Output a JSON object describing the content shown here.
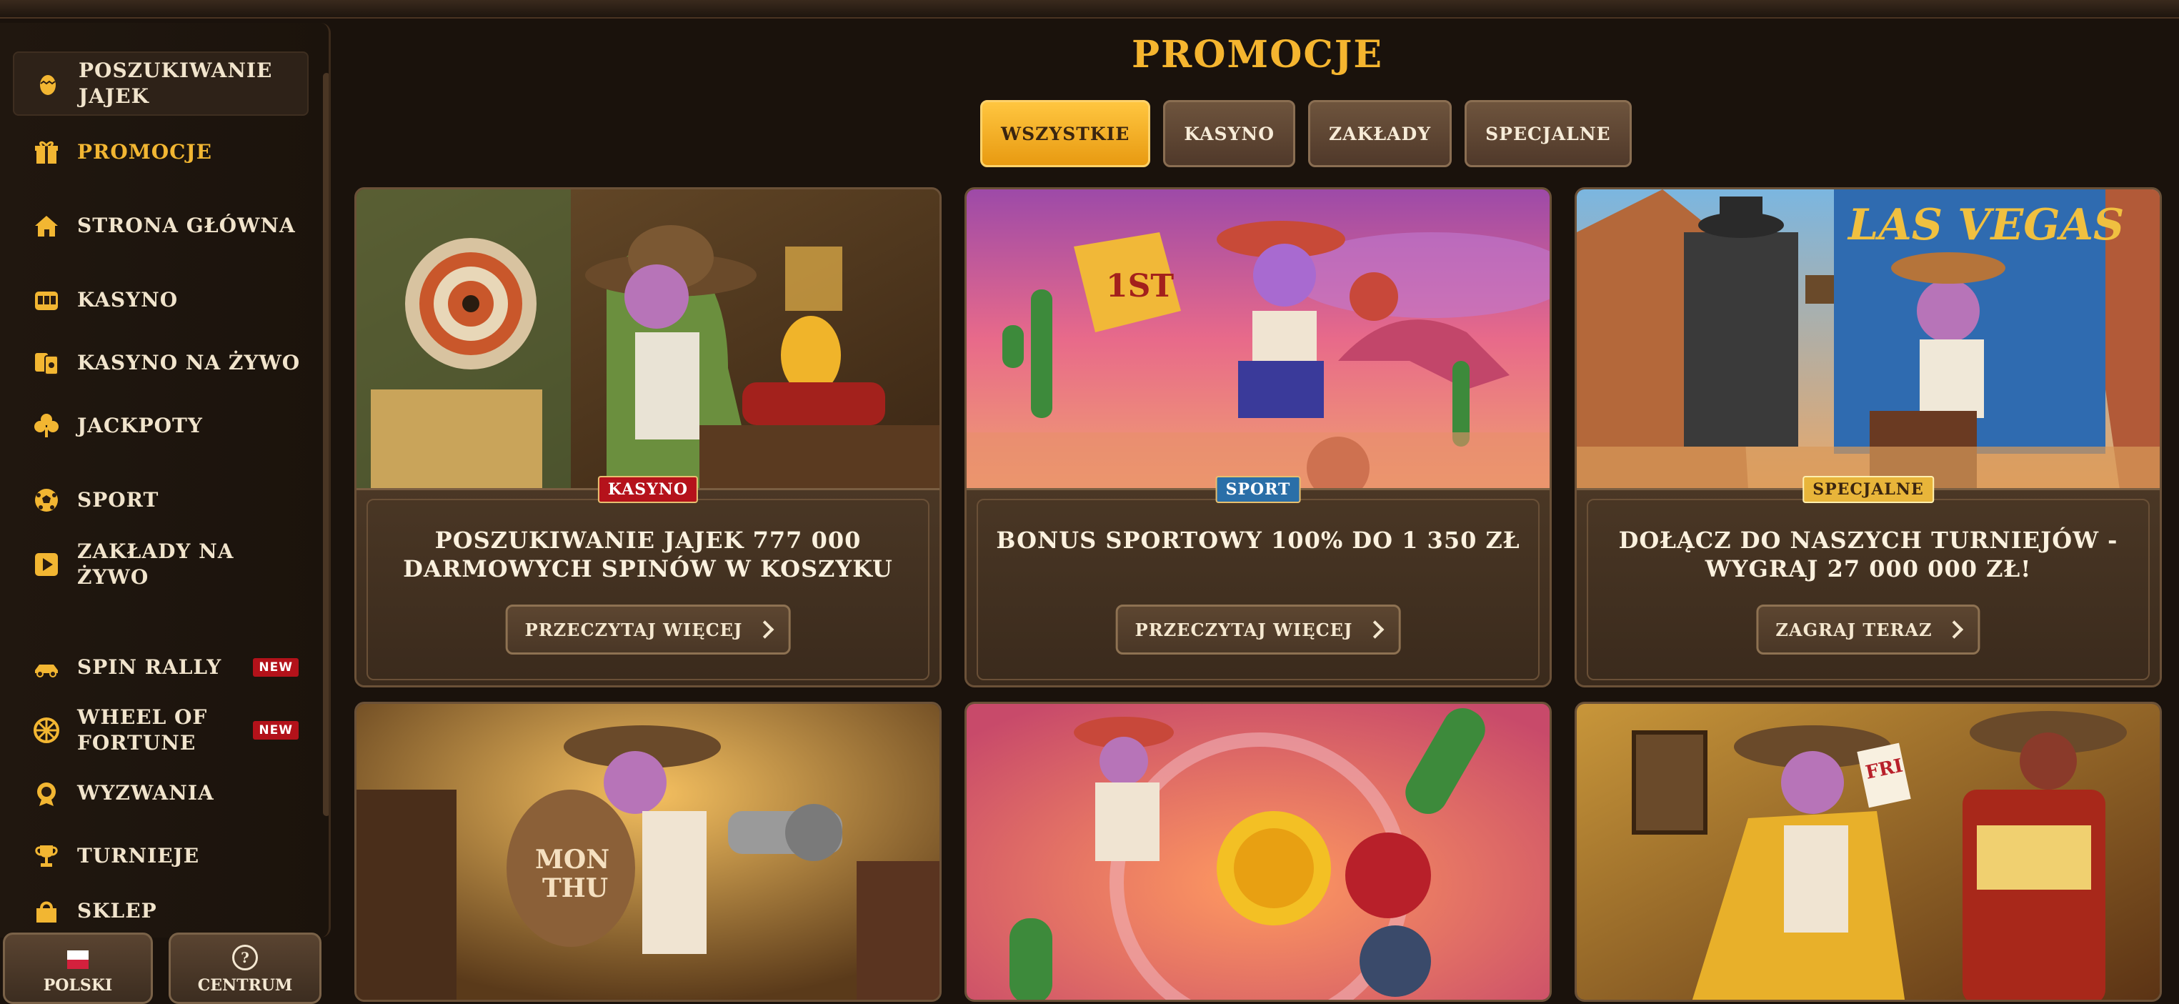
{
  "page": {
    "title": "PROMOCJE"
  },
  "filters": [
    {
      "label": "WSZYSTKIE",
      "active": true
    },
    {
      "label": "KASYNO",
      "active": false
    },
    {
      "label": "ZAKŁADY",
      "active": false
    },
    {
      "label": "SPECJALNE",
      "active": false
    }
  ],
  "sidebar": {
    "items": [
      {
        "label": "POSZUKIWANIE\nJAJEK",
        "icon": "egg-icon"
      },
      {
        "label": "PROMOCJE",
        "icon": "gift-icon"
      },
      {
        "label": "STRONA GŁÓWNA",
        "icon": "home-icon"
      },
      {
        "label": "KASYNO",
        "icon": "slot-machine-icon"
      },
      {
        "label": "KASYNO NA ŻYWO",
        "icon": "cards-icon"
      },
      {
        "label": "JACKPOTY",
        "icon": "clover-icon"
      },
      {
        "label": "SPORT",
        "icon": "soccer-ball-icon"
      },
      {
        "label": "ZAKŁADY NA\nŻYWO",
        "icon": "play-icon"
      },
      {
        "label": "SPIN RALLY",
        "icon": "race-car-icon",
        "badge": "NEW"
      },
      {
        "label": "WHEEL OF\nFORTUNE",
        "icon": "wheel-icon",
        "badge": "NEW"
      },
      {
        "label": "WYZWANIA",
        "icon": "medal-icon"
      },
      {
        "label": "TURNIEJE",
        "icon": "trophy-icon"
      },
      {
        "label": "SKLEP",
        "icon": "shop-icon"
      }
    ],
    "language": "POLSKI",
    "help": "CENTRUM"
  },
  "cards": [
    {
      "tag": "KASYNO",
      "tag_color": "#b5121b",
      "title": "POSZUKIWANIE JAJEK 777 000 DARMOWYCH SPINÓW W KOSZYKU",
      "button": "PRZECZYTAJ WIĘCEJ"
    },
    {
      "tag": "SPORT",
      "tag_color": "#2a6fa8",
      "title": "BONUS SPORTOWY 100% DO 1 350 ZŁ",
      "button": "PRZECZYTAJ WIĘCEJ"
    },
    {
      "tag": "SPECJALNE",
      "tag_color": "#e8b53a",
      "title": "DOŁĄCZ DO NASZYCH TURNIEJÓW - WYGRAJ 27 000 000 ZŁ!",
      "button": "ZAGRAJ TERAZ"
    }
  ],
  "colors": {
    "accent": "#f5b52f",
    "bg": "#1a120c"
  }
}
